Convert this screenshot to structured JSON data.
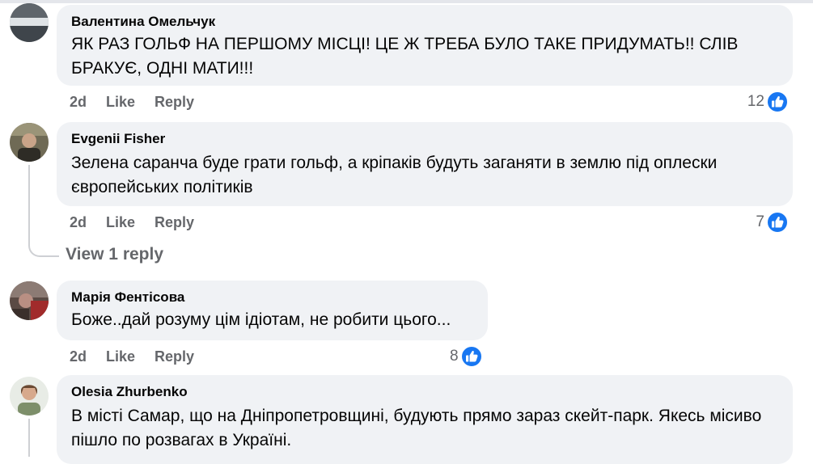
{
  "comments": [
    {
      "author": "Валентина Омельчук",
      "text": "ЯК РАЗ ГОЛЬФ НА ПЕРШОМУ МІСЦІ! ЦЕ Ж ТРЕБА БУЛО ТАКЕ ПРИДУМАТЬ!! СЛІВ БРАКУЄ, ОДНІ МАТИ!!!",
      "time": "2d",
      "like": "Like",
      "reply": "Reply",
      "reactions": "12"
    },
    {
      "author": "Evgenii Fisher",
      "text": "Зелена саранча буде грати гольф, а кріпаків будуть заганяти в землю під оплески європейських політиків",
      "time": "2d",
      "like": "Like",
      "reply": "Reply",
      "reactions": "7",
      "view_replies": "View 1 reply"
    },
    {
      "author": "Марія Фентісова",
      "text": "Боже..дай розуму цім ідіотам, не робити цього...",
      "time": "2d",
      "like": "Like",
      "reply": "Reply",
      "reactions": "8"
    },
    {
      "author": "Olesia Zhurbenko",
      "text": "В місті Самар, що на Дніпропетровщині, будують прямо зараз скейт-парк. Якесь місиво пішло по розвагах в Україні."
    }
  ],
  "icons": {
    "reaction": "like-reaction-icon"
  },
  "colors": {
    "bubble": "#f0f2f5",
    "meta_text": "#65676b",
    "like_blue": "#1877f2"
  }
}
